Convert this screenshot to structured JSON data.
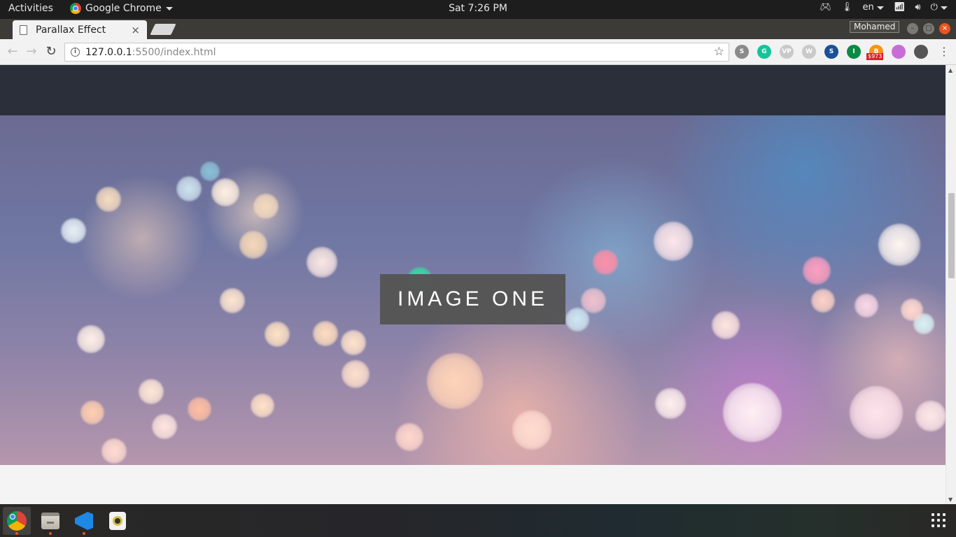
{
  "topbar": {
    "activities": "Activities",
    "app_name": "Google Chrome",
    "clock": "Sat  7:26 PM",
    "language": "en"
  },
  "tab": {
    "title": "Parallax Effect",
    "close": "×"
  },
  "profile": {
    "name": "Mohamed"
  },
  "toolbar": {
    "url_host": "127.0.0.1",
    "url_rest": ":5500/index.html",
    "extensions": [
      {
        "icon": "s-extension-icon",
        "label": "S",
        "color": "#8a8a8a"
      },
      {
        "icon": "grammarly-icon",
        "label": "G",
        "color": "#15c39a"
      },
      {
        "icon": "vp-icon",
        "label": "VP",
        "color": "#c9c9c9"
      },
      {
        "icon": "wordpress-icon",
        "label": "W",
        "color": "#c9c9c9"
      },
      {
        "icon": "steem-icon",
        "label": "S",
        "color": "#1a5099"
      },
      {
        "icon": "italy-extension-icon",
        "label": "I",
        "color": "#0b8a44"
      },
      {
        "icon": "bitcoin-icon",
        "label": "B",
        "color": "#f7931a",
        "badge": "$973"
      },
      {
        "icon": "paint-icon",
        "label": "",
        "color": "#c86dd7"
      },
      {
        "icon": "eyedropper-icon",
        "label": "",
        "color": "#555555"
      }
    ]
  },
  "page": {
    "hero_label": "IMAGE ONE"
  },
  "colors": {
    "topbar": "#1d1d1d",
    "tabstrip": "#3c3b37",
    "dark_band": "#2b2f39",
    "label_bg": "#555555",
    "ubuntu_orange": "#e95420"
  }
}
